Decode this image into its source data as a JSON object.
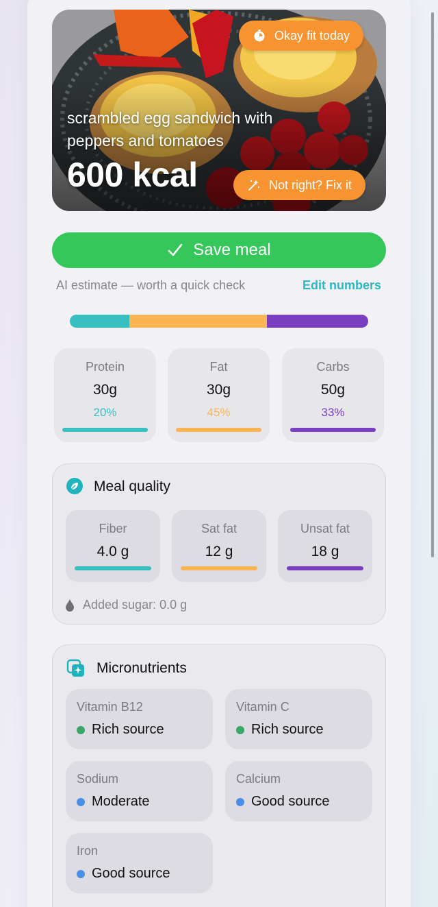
{
  "hero": {
    "fit_badge": "Okay fit today",
    "meal_name": "scrambled egg sandwich with peppers and tomatoes",
    "calories": "600 kcal",
    "fix_button": "Not right? Fix it"
  },
  "actions": {
    "save_label": "Save meal",
    "ai_note": "AI estimate — worth a quick check",
    "edit_link": "Edit numbers"
  },
  "macros": {
    "bar": [
      {
        "name": "Protein",
        "fraction": 0.2,
        "color": "#38bfbf"
      },
      {
        "name": "Fat",
        "fraction": 0.46,
        "color": "#fbb454"
      },
      {
        "name": "Carbs",
        "fraction": 0.34,
        "color": "#7a3fc0"
      }
    ],
    "cards": [
      {
        "label": "Protein",
        "grams": "30g",
        "percent": "20%",
        "color": "#38bfbf"
      },
      {
        "label": "Fat",
        "grams": "30g",
        "percent": "45%",
        "color": "#fbb454"
      },
      {
        "label": "Carbs",
        "grams": "50g",
        "percent": "33%",
        "color": "#7a3fc0"
      }
    ]
  },
  "quality": {
    "title": "Meal quality",
    "items": [
      {
        "label": "Fiber",
        "value": "4.0 g",
        "color": "#38bfbf"
      },
      {
        "label": "Sat fat",
        "value": "12 g",
        "color": "#fbb454"
      },
      {
        "label": "Unsat fat",
        "value": "18 g",
        "color": "#7a3fc0"
      }
    ],
    "added_sugar": "Added sugar: 0.0 g"
  },
  "micros": {
    "title": "Micronutrients",
    "items": [
      {
        "name": "Vitamin B12",
        "level": "Rich source",
        "dot_color": "#3aa66a"
      },
      {
        "name": "Vitamin C",
        "level": "Rich source",
        "dot_color": "#3aa66a"
      },
      {
        "name": "Sodium",
        "level": "Moderate",
        "dot_color": "#4a8ee6"
      },
      {
        "name": "Calcium",
        "level": "Good source",
        "dot_color": "#4a8ee6"
      },
      {
        "name": "Iron",
        "level": "Good source",
        "dot_color": "#4a8ee6"
      }
    ]
  },
  "colors": {
    "accent_orange": "#f79330",
    "save_green": "#35c759",
    "link_teal": "#2bb8c2"
  }
}
